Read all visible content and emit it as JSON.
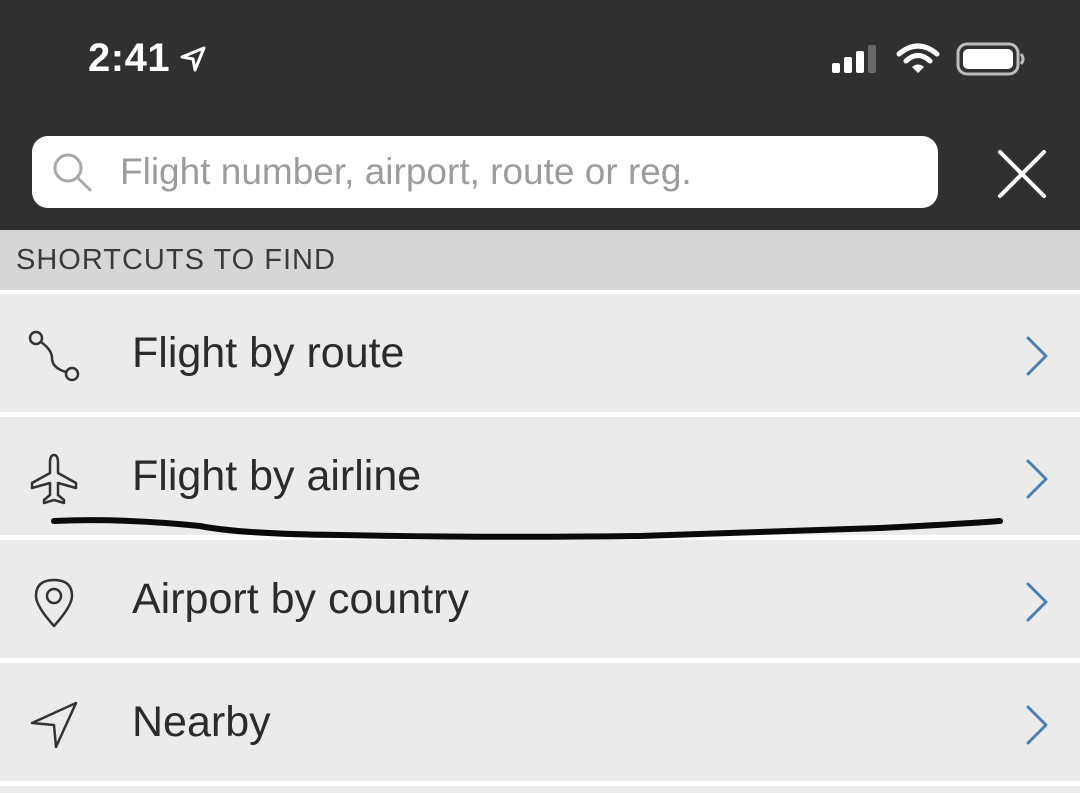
{
  "status_bar": {
    "time": "2:41",
    "icons": [
      "location-arrow-icon",
      "cellular-signal-icon",
      "wifi-icon",
      "battery-icon"
    ]
  },
  "search": {
    "placeholder": "Flight number, airport, route or reg.",
    "value": ""
  },
  "section": {
    "title": "SHORTCUTS TO FIND"
  },
  "shortcuts": [
    {
      "label": "Flight by route",
      "icon": "route-icon"
    },
    {
      "label": "Flight by airline",
      "icon": "airplane-icon"
    },
    {
      "label": "Airport by country",
      "icon": "map-pin-icon"
    },
    {
      "label": "Nearby",
      "icon": "navigation-arrow-icon"
    }
  ],
  "colors": {
    "header_bg": "#303030",
    "section_bg": "#d6d6d6",
    "row_bg": "#ebebeb",
    "chevron": "#4a7fb5",
    "icon_stroke": "#333333"
  }
}
